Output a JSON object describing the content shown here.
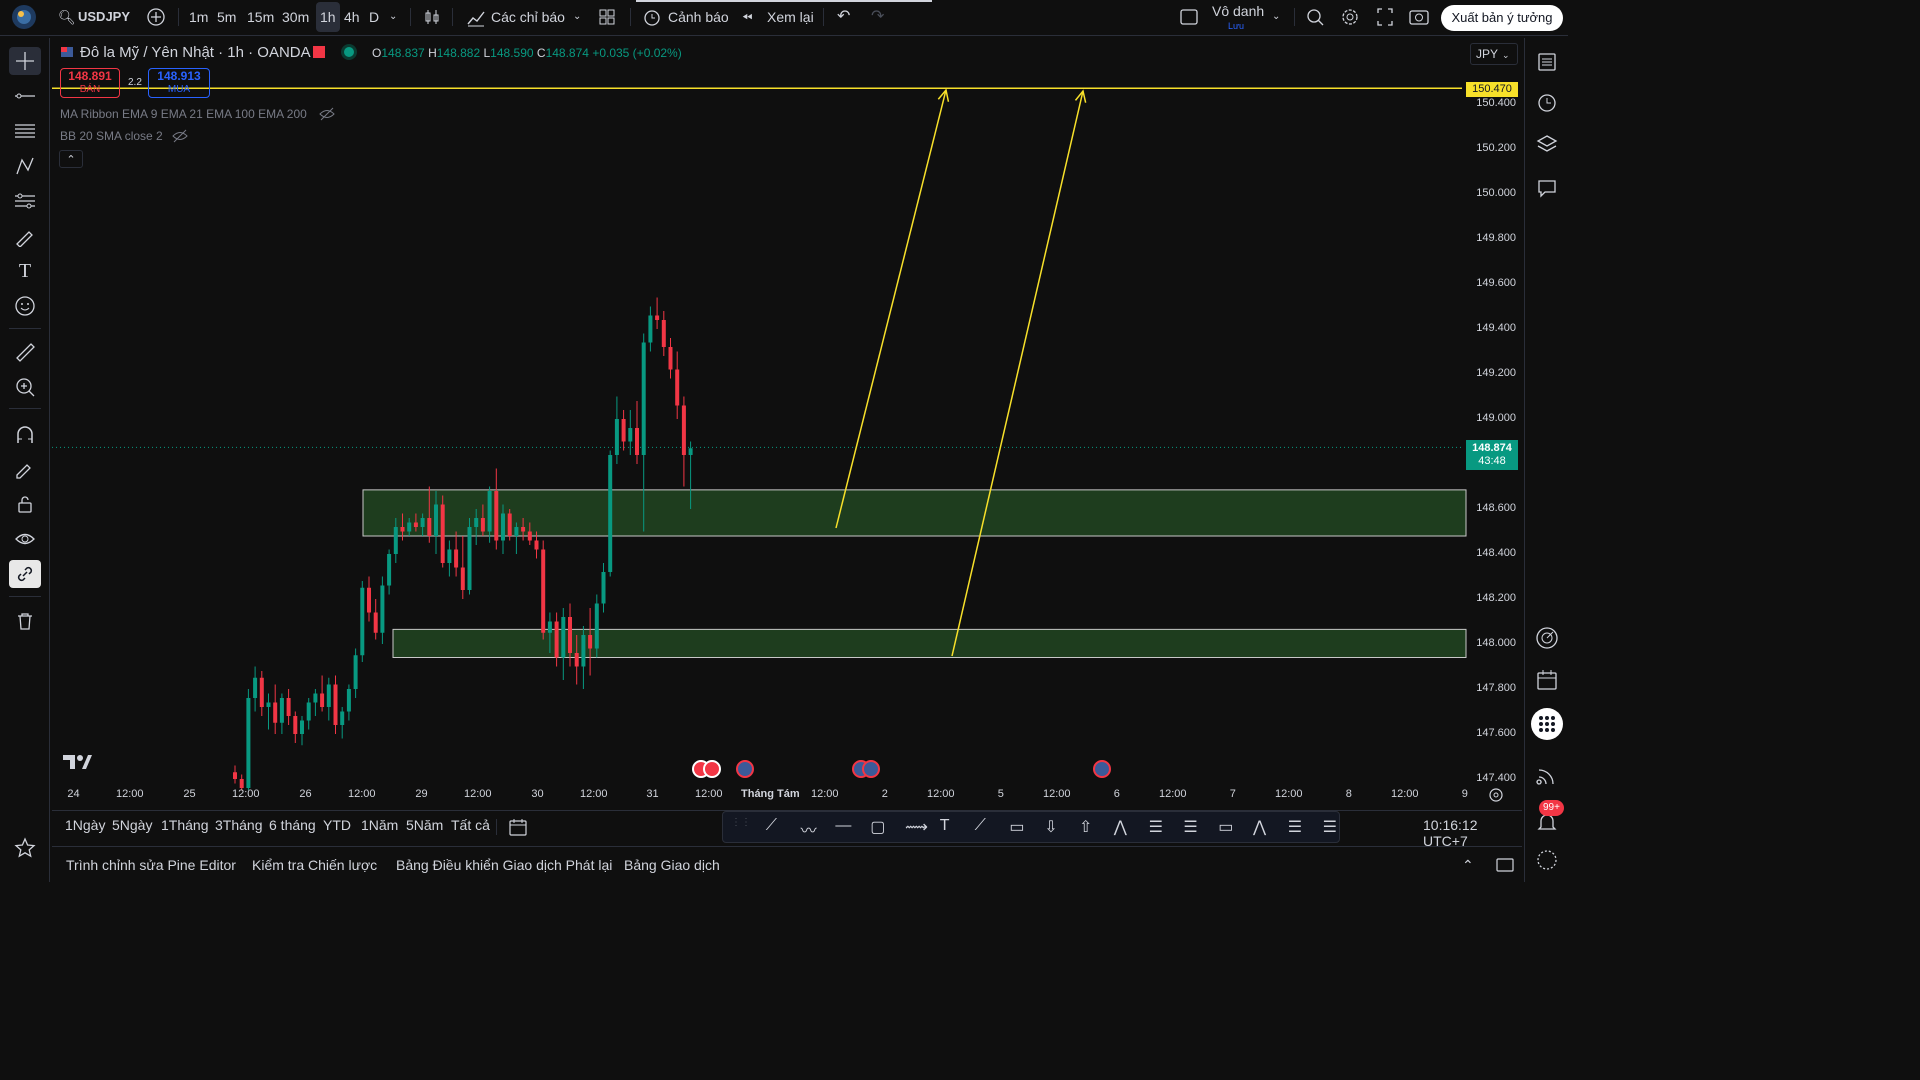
{
  "header": {
    "symbol": "USDJPY",
    "timeframes": [
      "1m",
      "5m",
      "15m",
      "30m",
      "1h",
      "4h",
      "D"
    ],
    "active_timeframe": "1h",
    "indicators_label": "Các chỉ báo",
    "alert_label": "Cảnh báo",
    "replay_label": "Xem lại",
    "layout_name": "Vô danh",
    "layout_sub": "Lưu",
    "publish_label": "Xuất bản ý tưởng"
  },
  "chart": {
    "title": "Đô la Mỹ / Yên Nhật · 1h · OANDA",
    "ohlc": {
      "o_label": "O",
      "o": "148.837",
      "h_label": "H",
      "h": "148.882",
      "l_label": "L",
      "l": "148.590",
      "c_label": "C",
      "c": "148.874",
      "change": "+0.035 (+0.02%)"
    },
    "sell": {
      "price": "148.891",
      "label": "BÁN"
    },
    "spread": "2.2",
    "buy": {
      "price": "148.913",
      "label": "MUA"
    },
    "indicator1": "MA Ribbon EMA 9 EMA 21 EMA 100 EMA 200",
    "indicator2": "BB 20 SMA close 2",
    "currency": "JPY",
    "price_axis": [
      "150.400",
      "150.200",
      "150.000",
      "149.800",
      "149.600",
      "149.400",
      "149.200",
      "149.000",
      "148.600",
      "148.400",
      "148.200",
      "148.000",
      "147.800",
      "147.600",
      "147.400"
    ],
    "hline_price": "150.470",
    "last_price": "148.874",
    "countdown": "43:48",
    "time_axis": [
      "24",
      "12:00",
      "25",
      "12:00",
      "26",
      "12:00",
      "29",
      "12:00",
      "30",
      "12:00",
      "31",
      "12:00",
      "Tháng Tám",
      "12:00",
      "2",
      "12:00",
      "5",
      "12:00",
      "6",
      "12:00",
      "7",
      "12:00",
      "8",
      "12:00",
      "9"
    ],
    "colors": {
      "up": "#089981",
      "down": "#f23645",
      "zone_fill": "#1e3d1e",
      "hline": "#f7e02a",
      "arrow": "#f7e02a",
      "last_price_bg": "#089981"
    }
  },
  "range_bar": {
    "ranges": [
      "1Ngày",
      "5Ngày",
      "1Tháng",
      "3Tháng",
      "6 tháng",
      "YTD",
      "1Năm",
      "5Năm",
      "Tất cả"
    ],
    "clock": "10:16:12 UTC+7"
  },
  "panel_bar": {
    "tabs": [
      "Trình chỉnh sửa Pine Editor",
      "Kiểm tra Chiến lược",
      "Bảng Điều khiển Giao dịch Phát lại",
      "Bảng Giao dịch"
    ]
  },
  "notifications": {
    "badge": "99+"
  }
}
